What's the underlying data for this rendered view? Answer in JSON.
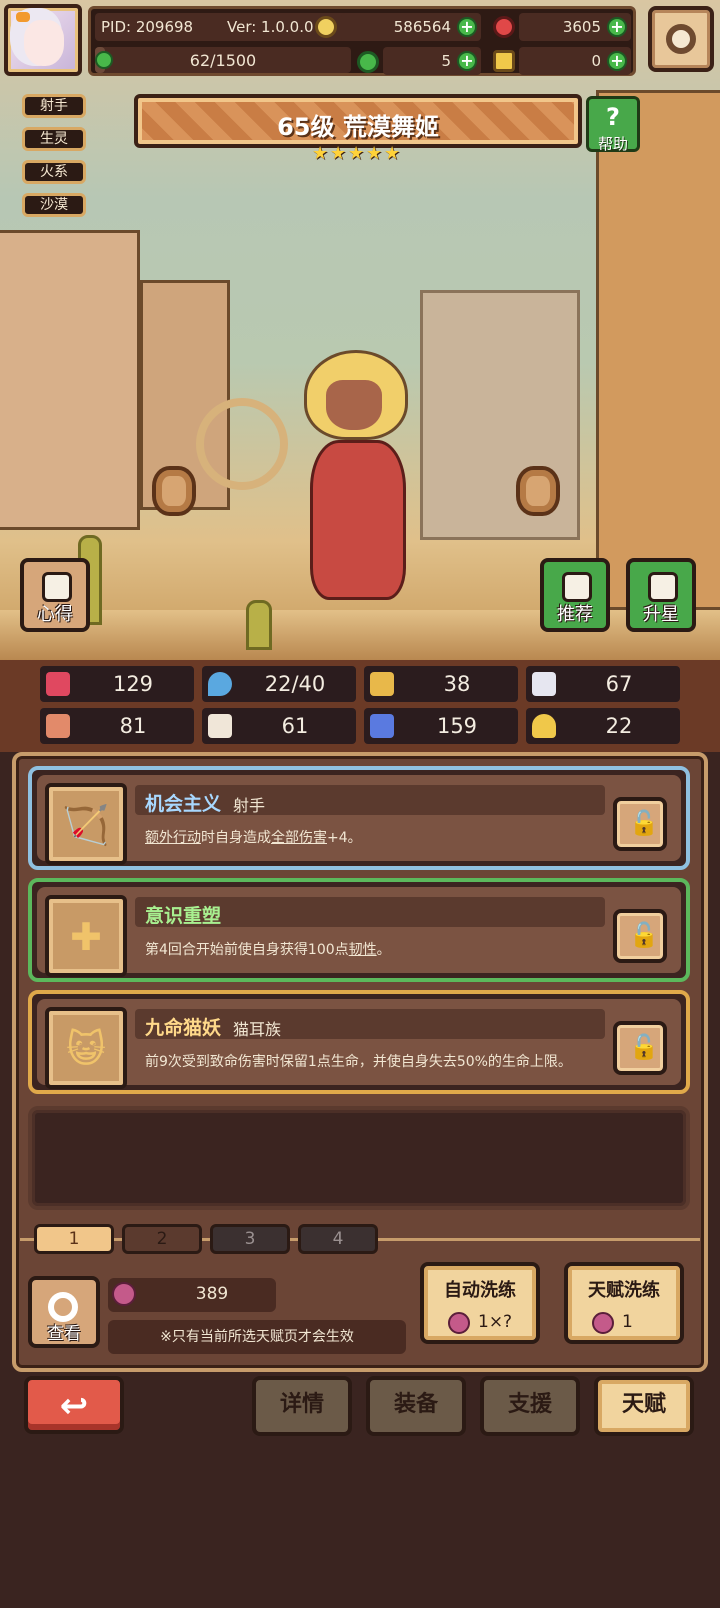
{
  "top_bar": {
    "pid": "PID: 209698",
    "version": "Ver: 1.0.0.0",
    "gold": "586564",
    "gems": "3605",
    "xp": "62/1500",
    "clover": "5",
    "key": "0",
    "xp_fraction": 0.04
  },
  "tags": [
    "射手",
    "生灵",
    "火系",
    "沙漠"
  ],
  "hero": {
    "title": "65级 荒漠舞姬",
    "stars": 5
  },
  "buttons": {
    "help": "帮助",
    "insight": "心得",
    "recommend": "推荐",
    "star_up": "升星",
    "view": "查看"
  },
  "stats": [
    {
      "icon": "heart-icon",
      "value": "129",
      "color": "#e04860"
    },
    {
      "icon": "water-drop-icon",
      "value": "22/40",
      "color": "#5aa8e0"
    },
    {
      "icon": "shield-icon",
      "value": "38",
      "color": "#e8b84a"
    },
    {
      "icon": "wing-icon",
      "value": "67",
      "color": "#e6e6f0"
    },
    {
      "icon": "fist-icon",
      "value": "81",
      "color": "#e28a6a"
    },
    {
      "icon": "book-icon",
      "value": "61",
      "color": "#f0e6d8"
    },
    {
      "icon": "spellbook-icon",
      "value": "159",
      "color": "#5a7ae0"
    },
    {
      "icon": "horseshoe-icon",
      "value": "22",
      "color": "#f0c84a"
    }
  ],
  "talents": [
    {
      "name": "机会主义",
      "type": "射手",
      "name_color": "#a8d8ff",
      "border": "#8fc0e0",
      "desc_parts": [
        "额外行动",
        "时自身造成",
        "全部伤害",
        "+4。"
      ],
      "icon": "bow-icon"
    },
    {
      "name": "意识重塑",
      "type": "",
      "name_color": "#a8f090",
      "border": "#5cb85c",
      "desc_parts": [
        "第4回合开始前使自身获得100点",
        "韧性",
        "。"
      ],
      "icon": "cross-icon"
    },
    {
      "name": "九命猫妖",
      "type": "猫耳族",
      "name_color": "#ffd98a",
      "border": "#e0a94a",
      "desc_parts": [
        "前9次受到致命伤害时保留1点生命，并使自身失去50%的生命上限。"
      ],
      "icon": "cat-icon"
    }
  ],
  "page_tabs": [
    "1",
    "2",
    "3",
    "4"
  ],
  "berries": "389",
  "note": "※只有当前所选天赋页才会生效",
  "reroll": {
    "auto_label": "自动洗练",
    "auto_cost": "1×?",
    "talent_label": "天赋洗练",
    "talent_cost": "1"
  },
  "nav": {
    "back": "↩",
    "details": "详情",
    "equipment": "装备",
    "support": "支援",
    "talent": "天赋"
  }
}
